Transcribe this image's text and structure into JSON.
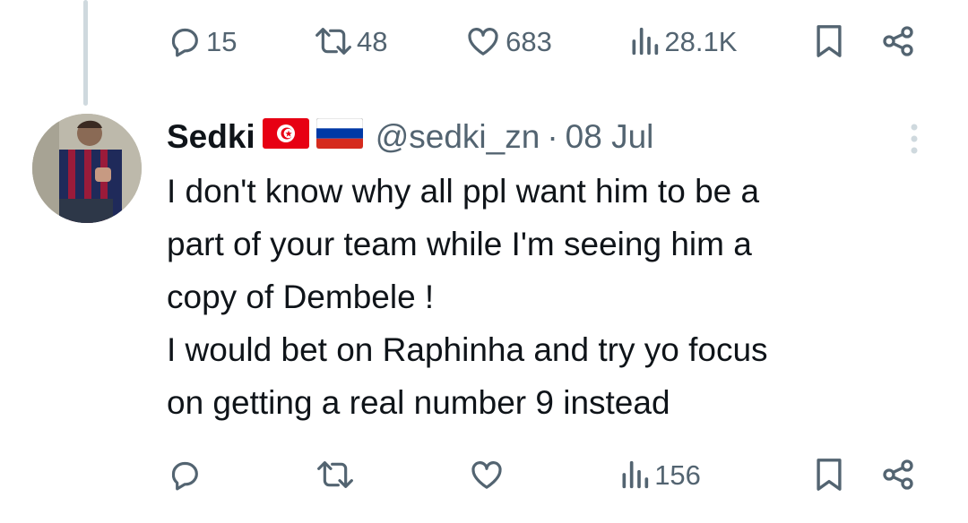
{
  "parent_actions": {
    "replies": "15",
    "reposts": "48",
    "likes": "683",
    "views": "28.1K"
  },
  "reply": {
    "name": "Sedki",
    "flags": [
      "tunisia-flag",
      "russia-flag"
    ],
    "handle": "@sedki_zn",
    "separator": "·",
    "date": "08 Jul",
    "text": "I don't know why all ppl want him to be a\npart of your team while I'm seeing him a\ncopy of Dembele !\nI would bet on Raphinha and try yo focus\non getting a real number 9 instead",
    "actions": {
      "views": "156"
    }
  },
  "colors": {
    "text": "#0f1419",
    "secondary": "#536471",
    "thread_line": "#cfd9de"
  }
}
